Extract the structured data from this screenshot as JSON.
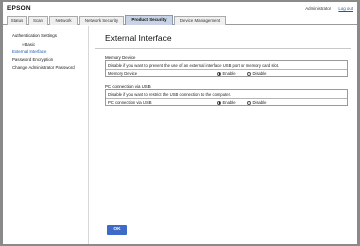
{
  "header": {
    "brand": "EPSON",
    "user": "Administrator",
    "logout_label": "Log out"
  },
  "tabs": [
    {
      "label": "Status"
    },
    {
      "label": "Scan"
    },
    {
      "label": "Network"
    },
    {
      "label": "Network Security"
    },
    {
      "label": "Product Security"
    },
    {
      "label": "Device Management"
    }
  ],
  "active_tab": "Product Security",
  "sidebar": {
    "items": [
      {
        "label": "Authentication Settings"
      },
      {
        "label": "»Basic"
      },
      {
        "label": "External Interface"
      },
      {
        "label": "Password Encryption"
      },
      {
        "label": "Change Administrator Password"
      }
    ],
    "active_item": "External Interface"
  },
  "main": {
    "title": "External Interface",
    "memory": {
      "heading": "Memory Device",
      "description": "Disable if you want to prevent the use of an external interface USB port or memory card slot.",
      "row_label": "Memory Device",
      "options": [
        "Enable",
        "Disable"
      ],
      "selected": "Enable"
    },
    "pc": {
      "heading": "PC connection via USB",
      "description": "Disable if you want to restrict the USB connection to the computer.",
      "row_label": "PC connection via USB",
      "options": [
        "Enable",
        "Disable"
      ],
      "selected": "Enable"
    },
    "ok_label": "OK"
  },
  "colors": {
    "accent": "#3d6bc7",
    "link": "#1a56b8",
    "active_tab": "#c8d3e6"
  }
}
